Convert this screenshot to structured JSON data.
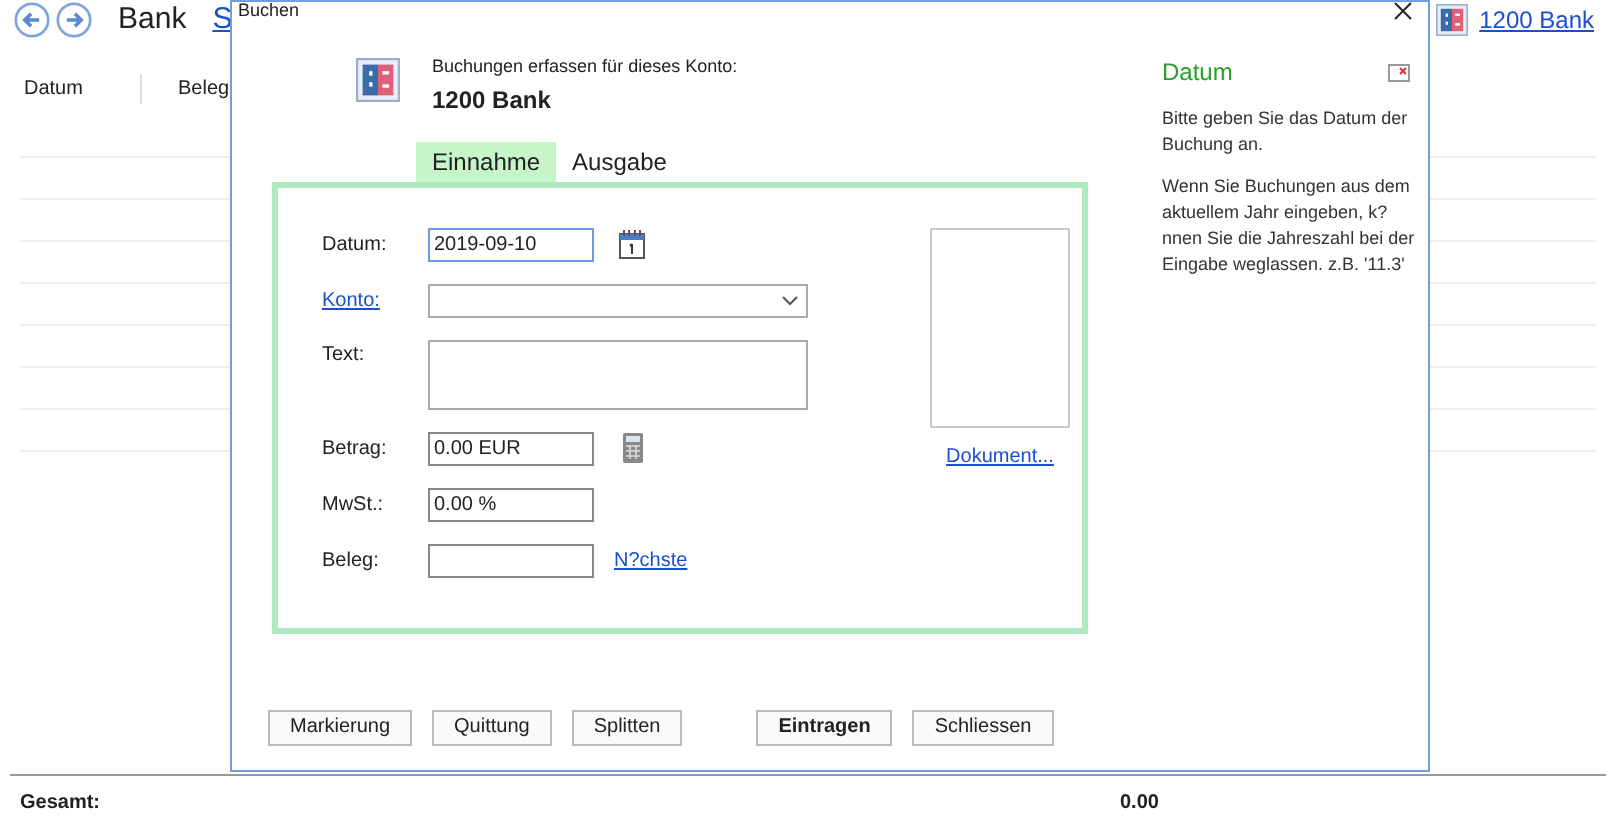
{
  "background": {
    "nav_title": "Bank",
    "nav_link": "S",
    "columns": [
      "Datum",
      "Beleg"
    ],
    "account_link": "1200 Bank",
    "total_label": "Gesamt:",
    "total_value": "0.00"
  },
  "dialog": {
    "title": "Buchen",
    "header_caption": "Buchungen erfassen für dieses Konto:",
    "header_account": "1200 Bank",
    "tabs": [
      {
        "label": "Einnahme",
        "selected": true
      },
      {
        "label": "Ausgabe",
        "selected": false
      }
    ],
    "fields": [
      {
        "kind": "date",
        "label": "Datum:",
        "linked": false,
        "value": "2019-09-10"
      },
      {
        "kind": "select",
        "label": "Konto:",
        "linked": true
      },
      {
        "kind": "textarea",
        "label": "Text:",
        "linked": false
      },
      {
        "kind": "amount",
        "label": "Betrag:",
        "linked": false,
        "value": "0.00 EUR"
      },
      {
        "kind": "text",
        "label": "MwSt.:",
        "linked": false,
        "value": "0.00 %"
      },
      {
        "kind": "voucher",
        "label": "Beleg:",
        "linked": false,
        "link": "N?chste"
      }
    ],
    "document_link": "Dokument...",
    "help": {
      "title": "Datum",
      "paragraphs": [
        "Bitte geben Sie das Datum der Buchung an.",
        "Wenn Sie Buchungen aus dem aktuellem Jahr eingeben, k?nnen Sie die Jahreszahl bei der Eingabe weglassen. z.B. '11.3'"
      ]
    },
    "left_buttons": [
      {
        "label": "Markierung",
        "default": false
      },
      {
        "label": "Quittung",
        "default": false
      },
      {
        "label": "Splitten",
        "default": false
      }
    ],
    "right_buttons": [
      {
        "label": "Eintragen",
        "default": true
      },
      {
        "label": "Schliessen",
        "default": false
      }
    ]
  }
}
